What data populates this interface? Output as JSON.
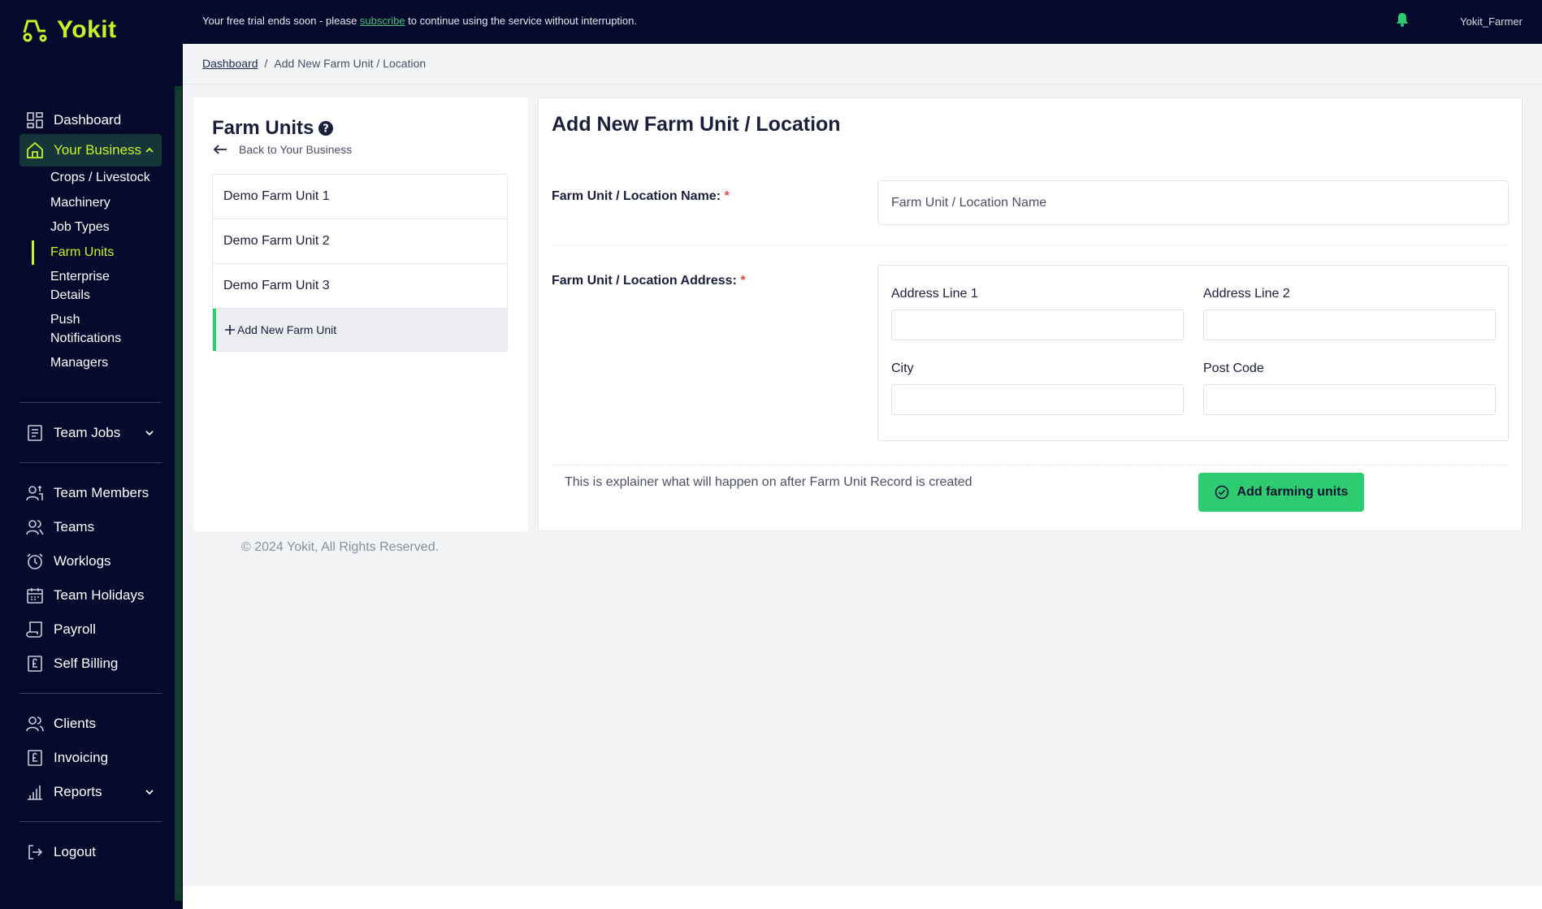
{
  "app": {
    "name": "Yokit"
  },
  "topbar": {
    "trial_prefix": "Your free trial ends soon - please ",
    "trial_link": "subscribe",
    "trial_suffix": " to continue using the service without interruption.",
    "username": "Yokit_Farmer"
  },
  "sidebar": {
    "dashboard": "Dashboard",
    "your_business": "Your Business",
    "business_sub": [
      "Crops / Livestock",
      "Machinery",
      "Job Types",
      "Farm Units",
      "Enterprise Details",
      "Push Notifications",
      "Managers"
    ],
    "team_jobs": "Team Jobs",
    "team_members": "Team Members",
    "teams": "Teams",
    "worklogs": "Worklogs",
    "team_holidays": "Team Holidays",
    "payroll": "Payroll",
    "self_billing": "Self Billing",
    "clients": "Clients",
    "invoicing": "Invoicing",
    "reports": "Reports",
    "logout": "Logout"
  },
  "breadcrumb": {
    "home": "Dashboard",
    "separator": "/",
    "current": "Add New Farm Unit / Location"
  },
  "farm_units": {
    "title": "Farm Units",
    "back": "Back to Your Business",
    "items": [
      "Demo Farm Unit 1",
      "Demo Farm Unit 2",
      "Demo Farm Unit 3"
    ],
    "add": "Add New Farm Unit"
  },
  "form": {
    "title": "Add New Farm Unit / Location",
    "name_label": "Farm Unit / Location Name:",
    "name_placeholder": "Farm Unit / Location Name",
    "address_label": "Farm Unit / Location Address:",
    "required_mark": "*",
    "address_line1": "Address Line 1",
    "address_line2": "Address Line 2",
    "city": "City",
    "post_code": "Post Code",
    "explainer": "This is explainer what will happen on after Farm Unit Record is created",
    "submit": "Add farming units"
  },
  "footer": {
    "copyright": "© 2024 Yokit, All Rights Reserved."
  },
  "colors": {
    "sidebar_bg": "#050a2d",
    "accent": "#c8f227",
    "success": "#2ecc71",
    "required": "#e74c3c"
  }
}
